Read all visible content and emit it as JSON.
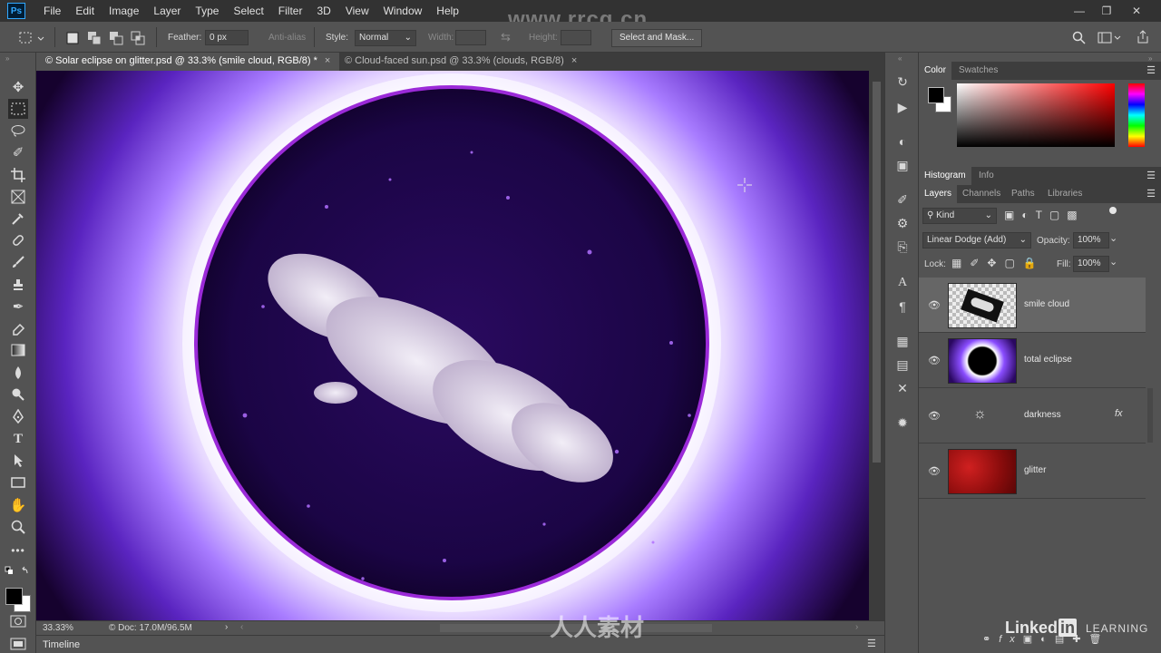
{
  "app": {
    "logo": "Ps"
  },
  "menu": [
    "File",
    "Edit",
    "Image",
    "Layer",
    "Type",
    "Select",
    "Filter",
    "3D",
    "View",
    "Window",
    "Help"
  ],
  "watermark_top": "www.rrcg.cn",
  "watermark_bottom": "人人素材",
  "options": {
    "feather_label": "Feather:",
    "feather_value": "0 px",
    "anti_alias_label": "Anti-alias",
    "style_label": "Style:",
    "style_value": "Normal",
    "width_label": "Width:",
    "height_label": "Height:",
    "select_and_mask_label": "Select and Mask..."
  },
  "tabs": [
    {
      "label": "© Solar eclipse on glitter.psd @ 33.3% (smile cloud, RGB/8) *",
      "active": true
    },
    {
      "label": "© Cloud-faced sun.psd @ 33.3% (clouds, RGB/8)",
      "active": false
    }
  ],
  "status": {
    "zoom": "33.33%",
    "doc": "© Doc: 17.0M/96.5M"
  },
  "timeline": {
    "label": "Timeline"
  },
  "color_panel": {
    "tabs": [
      "Color",
      "Swatches"
    ],
    "foreground": "#000000",
    "background": "#ffffff"
  },
  "histogram_panel": {
    "tabs": [
      "Histogram",
      "Info"
    ]
  },
  "layers_panel": {
    "tabs": [
      "Layers",
      "Channels",
      "Paths",
      "Libraries"
    ],
    "kind_label": "Kind",
    "blend_mode": "Linear Dodge (Add)",
    "opacity_label": "Opacity:",
    "opacity_value": "100%",
    "lock_label": "Lock:",
    "fill_label": "Fill:",
    "fill_value": "100%",
    "layers": [
      {
        "name": "smile cloud",
        "selected": true
      },
      {
        "name": "total eclipse",
        "selected": false
      },
      {
        "name": "darkness",
        "selected": false,
        "fx": "fx"
      },
      {
        "name": "glitter",
        "selected": false
      }
    ]
  },
  "branding": {
    "linkedin": "Linked",
    "in": "in",
    "learning": "LEARNING"
  },
  "colors": {
    "accent": "#31a8ff",
    "corona": "#8a4dff",
    "disc": "#1a0540"
  }
}
